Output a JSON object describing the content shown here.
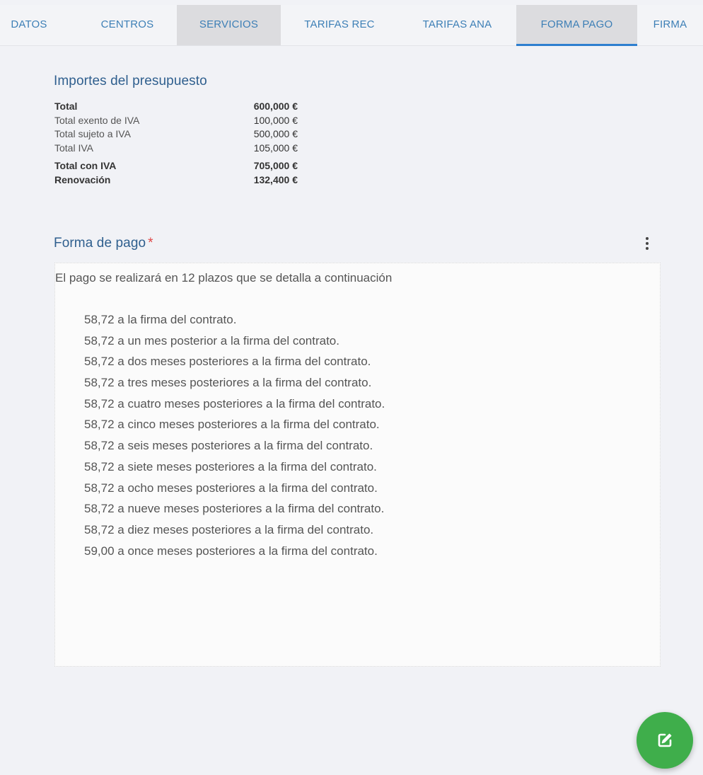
{
  "tabs": [
    {
      "label": "DATOS"
    },
    {
      "label": "CENTROS"
    },
    {
      "label": "SERVICIOS"
    },
    {
      "label": "TARIFAS REC"
    },
    {
      "label": "TARIFAS ANA"
    },
    {
      "label": "FORMA PAGO"
    },
    {
      "label": "FIRMA"
    }
  ],
  "active_tab": "FORMA PAGO",
  "amounts": {
    "title": "Importes del presupuesto",
    "rows": [
      {
        "label": "Total",
        "value": "600,000 €"
      },
      {
        "label": "Total exento de IVA",
        "value": "100,000 €"
      },
      {
        "label": "Total sujeto a IVA",
        "value": "500,000 €"
      },
      {
        "label": "Total IVA",
        "value": "105,000 €"
      },
      {
        "label": "Total con IVA",
        "value": "705,000 €"
      },
      {
        "label": "Renovación",
        "value": "132,400 €"
      }
    ]
  },
  "payment": {
    "title": "Forma de pago",
    "required_mark": "*",
    "intro": "El pago se realizará en 12 plazos que se detalla a continuación",
    "items": [
      "58,72 a la firma del contrato.",
      "58,72 a un mes posterior a la firma del contrato.",
      "58,72 a dos meses posteriores a la firma del contrato.",
      "58,72 a tres meses posteriores a la firma del contrato.",
      "58,72 a cuatro meses posteriores a la firma del contrato.",
      "58,72 a cinco meses posteriores a la firma del contrato.",
      "58,72 a seis meses posteriores a la firma del contrato.",
      "58,72 a siete meses posteriores a la firma del contrato.",
      "58,72 a ocho meses posteriores a la firma del contrato.",
      "58,72 a nueve meses posteriores a la firma del contrato.",
      "58,72 a diez meses posteriores a la firma del contrato.",
      "59,00 a once meses posteriores a la firma del contrato."
    ]
  },
  "icons": {
    "menu": "more-vert-icon",
    "fab": "edit-icon"
  },
  "colors": {
    "tab_text": "#3d7fb6",
    "tab_indicator": "#2e7fcf",
    "section_title": "#2f5f8e",
    "required": "#e04747",
    "fab": "#3fae4b"
  }
}
